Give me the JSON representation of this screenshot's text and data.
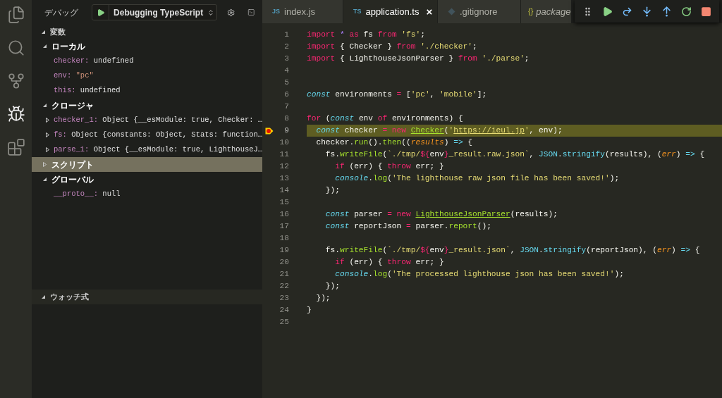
{
  "activity_bar": [
    {
      "kind": "files",
      "selected": false
    },
    {
      "kind": "search",
      "selected": false
    },
    {
      "kind": "source-control",
      "selected": false
    },
    {
      "kind": "debug",
      "selected": true
    },
    {
      "kind": "extensions",
      "selected": false
    }
  ],
  "sidebar": {
    "title": "デバッグ",
    "launch_config": "Debugging TypeScript"
  },
  "variables": {
    "title": "変数",
    "expanded": true,
    "scopes": [
      {
        "label": "ローカル",
        "expanded": true,
        "selected": false,
        "children": [
          {
            "name": "checker:",
            "value": {
              "text": "undefined",
              "kind": "plain"
            },
            "kind": "leaf"
          },
          {
            "name": "env:",
            "value": {
              "text": "\"pc\"",
              "kind": "string"
            },
            "kind": "leaf"
          },
          {
            "name": "this:",
            "value": {
              "text": "undefined",
              "kind": "plain"
            },
            "kind": "leaf"
          }
        ]
      },
      {
        "label": "クロージャ",
        "expanded": true,
        "selected": false,
        "children": [
          {
            "name": "checker_1:",
            "value": {
              "text": "Object {__esModule: true, Checker: …",
              "kind": "plain"
            },
            "kind": "object",
            "expanded": false
          },
          {
            "name": "fs:",
            "value": {
              "text": "Object {constants: Object, Stats: function…",
              "kind": "plain"
            },
            "kind": "object",
            "expanded": false
          },
          {
            "name": "parse_1:",
            "value": {
              "text": "Object {__esModule: true, LighthouseJ…",
              "kind": "plain"
            },
            "kind": "object",
            "expanded": false
          }
        ]
      },
      {
        "label": "スクリプト",
        "expanded": false,
        "selected": true
      },
      {
        "label": "グローバル",
        "expanded": true,
        "selected": false,
        "children": [
          {
            "name": "__proto__:",
            "value": {
              "text": "null",
              "kind": "plain"
            },
            "kind": "leaf"
          }
        ]
      }
    ]
  },
  "watch": {
    "title": "ウォッチ式",
    "expanded": true
  },
  "tabs": [
    {
      "label": "index.js",
      "badge": "JS",
      "kind": "js",
      "selected": false
    },
    {
      "label": "application.ts",
      "badge": "TS",
      "kind": "ts",
      "selected": true,
      "close": "×"
    },
    {
      "label": ".gitignore",
      "kind": "git",
      "selected": false
    },
    {
      "label": "package",
      "badge": "{}",
      "kind": "json",
      "selected": false
    }
  ],
  "debug_toolbar": [
    {
      "kind": "grip"
    },
    {
      "kind": "continue"
    },
    {
      "kind": "step-over"
    },
    {
      "kind": "step-into"
    },
    {
      "kind": "step-out"
    },
    {
      "kind": "restart"
    },
    {
      "kind": "stop"
    }
  ],
  "editor": {
    "lines": [
      {
        "number": "1",
        "current": false,
        "breakpoint": false,
        "tokens": [
          {
            "kind": "keyword",
            "text": "import "
          },
          {
            "kind": "constant",
            "text": "* "
          },
          {
            "kind": "keyword",
            "text": "as"
          },
          {
            "kind": "plain",
            "text": " fs "
          },
          {
            "kind": "keyword",
            "text": "from"
          },
          {
            "kind": "string",
            "text": " 'fs'"
          },
          {
            "kind": "plain",
            "text": ";"
          }
        ]
      },
      {
        "number": "2",
        "current": false,
        "breakpoint": false,
        "tokens": [
          {
            "kind": "keyword",
            "text": "import"
          },
          {
            "kind": "plain",
            "text": " { Checker } "
          },
          {
            "kind": "keyword",
            "text": "from"
          },
          {
            "kind": "string",
            "text": " './checker'"
          },
          {
            "kind": "plain",
            "text": ";"
          }
        ]
      },
      {
        "number": "3",
        "current": false,
        "breakpoint": false,
        "tokens": [
          {
            "kind": "keyword",
            "text": "import"
          },
          {
            "kind": "plain",
            "text": " { LighthouseJsonParser } "
          },
          {
            "kind": "keyword",
            "text": "from"
          },
          {
            "kind": "string",
            "text": " './parse'"
          },
          {
            "kind": "plain",
            "text": ";"
          }
        ]
      },
      {
        "number": "4",
        "current": false,
        "breakpoint": false
      },
      {
        "number": "5",
        "current": false,
        "breakpoint": false
      },
      {
        "number": "6",
        "current": false,
        "breakpoint": false,
        "tokens": [
          {
            "kind": "storage",
            "text": "const"
          },
          {
            "kind": "plain",
            "text": " environments "
          },
          {
            "kind": "keyword",
            "text": "="
          },
          {
            "kind": "plain",
            "text": " ["
          },
          {
            "kind": "string",
            "text": "'pc'"
          },
          {
            "kind": "plain",
            "text": ", "
          },
          {
            "kind": "string",
            "text": "'mobile'"
          },
          {
            "kind": "plain",
            "text": "];"
          }
        ]
      },
      {
        "number": "7",
        "current": false,
        "breakpoint": false
      },
      {
        "number": "8",
        "current": false,
        "breakpoint": false,
        "tokens": [
          {
            "kind": "keyword",
            "text": "for"
          },
          {
            "kind": "plain",
            "text": " ("
          },
          {
            "kind": "storage",
            "text": "const"
          },
          {
            "kind": "plain",
            "text": " env "
          },
          {
            "kind": "keyword",
            "text": "of"
          },
          {
            "kind": "plain",
            "text": " environments) {"
          }
        ]
      },
      {
        "number": "9",
        "current": true,
        "breakpoint": true,
        "tokens": [
          {
            "kind": "storage",
            "text": "  const"
          },
          {
            "kind": "plain",
            "text": " checker "
          },
          {
            "kind": "keyword",
            "text": "= new "
          },
          {
            "kind": "class",
            "text": "Checker"
          },
          {
            "kind": "plain",
            "text": "("
          },
          {
            "kind": "string",
            "text": "'"
          },
          {
            "kind": "link",
            "text": "https://ieul.jp"
          },
          {
            "kind": "string",
            "text": "'"
          },
          {
            "kind": "plain",
            "text": ", env);"
          }
        ]
      },
      {
        "number": "10",
        "current": false,
        "breakpoint": false,
        "tokens": [
          {
            "kind": "plain",
            "text": "  checker."
          },
          {
            "kind": "function",
            "text": "run"
          },
          {
            "kind": "plain",
            "text": "()."
          },
          {
            "kind": "function",
            "text": "then"
          },
          {
            "kind": "plain",
            "text": "(("
          },
          {
            "kind": "param",
            "text": "results"
          },
          {
            "kind": "plain",
            "text": ") "
          },
          {
            "kind": "arrow",
            "text": "=>"
          },
          {
            "kind": "plain",
            "text": " {"
          }
        ]
      },
      {
        "number": "11",
        "current": false,
        "breakpoint": false,
        "tokens": [
          {
            "kind": "plain",
            "text": "    fs."
          },
          {
            "kind": "function",
            "text": "writeFile"
          },
          {
            "kind": "plain",
            "text": "("
          },
          {
            "kind": "string",
            "text": "`./tmp/"
          },
          {
            "kind": "keyword",
            "text": "${"
          },
          {
            "kind": "plain",
            "text": "env"
          },
          {
            "kind": "keyword",
            "text": "}"
          },
          {
            "kind": "string",
            "text": "_result.raw.json`"
          },
          {
            "kind": "plain",
            "text": ", "
          },
          {
            "kind": "builtin",
            "text": "JSON"
          },
          {
            "kind": "plain",
            "text": "."
          },
          {
            "kind": "builtin",
            "text": "stringify"
          },
          {
            "kind": "plain",
            "text": "(results), ("
          },
          {
            "kind": "param",
            "text": "err"
          },
          {
            "kind": "plain",
            "text": ") "
          },
          {
            "kind": "arrow",
            "text": "=>"
          },
          {
            "kind": "plain",
            "text": " {"
          }
        ]
      },
      {
        "number": "12",
        "current": false,
        "breakpoint": false,
        "tokens": [
          {
            "kind": "keyword",
            "text": "      if"
          },
          {
            "kind": "plain",
            "text": " (err) { "
          },
          {
            "kind": "keyword",
            "text": "throw"
          },
          {
            "kind": "plain",
            "text": " err; }"
          }
        ]
      },
      {
        "number": "13",
        "current": false,
        "breakpoint": false,
        "tokens": [
          {
            "kind": "console",
            "text": "      console"
          },
          {
            "kind": "plain",
            "text": "."
          },
          {
            "kind": "function",
            "text": "log"
          },
          {
            "kind": "plain",
            "text": "("
          },
          {
            "kind": "string",
            "text": "'The lighthouse raw json file has been saved!'"
          },
          {
            "kind": "plain",
            "text": ");"
          }
        ]
      },
      {
        "number": "14",
        "current": false,
        "breakpoint": false,
        "tokens": [
          {
            "kind": "plain",
            "text": "    });"
          }
        ]
      },
      {
        "number": "15",
        "current": false,
        "breakpoint": false
      },
      {
        "number": "16",
        "current": false,
        "breakpoint": false,
        "tokens": [
          {
            "kind": "storage",
            "text": "    const"
          },
          {
            "kind": "plain",
            "text": " parser "
          },
          {
            "kind": "keyword",
            "text": "= new "
          },
          {
            "kind": "class",
            "text": "LighthouseJsonParser"
          },
          {
            "kind": "plain",
            "text": "(results);"
          }
        ]
      },
      {
        "number": "17",
        "current": false,
        "breakpoint": false,
        "tokens": [
          {
            "kind": "storage",
            "text": "    const"
          },
          {
            "kind": "plain",
            "text": " reportJson "
          },
          {
            "kind": "keyword",
            "text": "="
          },
          {
            "kind": "plain",
            "text": " parser."
          },
          {
            "kind": "function",
            "text": "report"
          },
          {
            "kind": "plain",
            "text": "();"
          }
        ]
      },
      {
        "number": "18",
        "current": false,
        "breakpoint": false
      },
      {
        "number": "19",
        "current": false,
        "breakpoint": false,
        "tokens": [
          {
            "kind": "plain",
            "text": "    fs."
          },
          {
            "kind": "function",
            "text": "writeFile"
          },
          {
            "kind": "plain",
            "text": "("
          },
          {
            "kind": "string",
            "text": "`./tmp/"
          },
          {
            "kind": "keyword",
            "text": "${"
          },
          {
            "kind": "plain",
            "text": "env"
          },
          {
            "kind": "keyword",
            "text": "}"
          },
          {
            "kind": "string",
            "text": "_result.json`"
          },
          {
            "kind": "plain",
            "text": ", "
          },
          {
            "kind": "builtin",
            "text": "JSON"
          },
          {
            "kind": "plain",
            "text": "."
          },
          {
            "kind": "builtin",
            "text": "stringify"
          },
          {
            "kind": "plain",
            "text": "(reportJson), ("
          },
          {
            "kind": "param",
            "text": "err"
          },
          {
            "kind": "plain",
            "text": ") "
          },
          {
            "kind": "arrow",
            "text": "=>"
          },
          {
            "kind": "plain",
            "text": " {"
          }
        ]
      },
      {
        "number": "20",
        "current": false,
        "breakpoint": false,
        "tokens": [
          {
            "kind": "keyword",
            "text": "      if"
          },
          {
            "kind": "plain",
            "text": " (err) { "
          },
          {
            "kind": "keyword",
            "text": "throw"
          },
          {
            "kind": "plain",
            "text": " err; }"
          }
        ]
      },
      {
        "number": "21",
        "current": false,
        "breakpoint": false,
        "tokens": [
          {
            "kind": "console",
            "text": "      console"
          },
          {
            "kind": "plain",
            "text": "."
          },
          {
            "kind": "function",
            "text": "log"
          },
          {
            "kind": "plain",
            "text": "("
          },
          {
            "kind": "string",
            "text": "'The processed lighthouse json has been saved!'"
          },
          {
            "kind": "plain",
            "text": ");"
          }
        ]
      },
      {
        "number": "22",
        "current": false,
        "breakpoint": false,
        "tokens": [
          {
            "kind": "plain",
            "text": "    });"
          }
        ]
      },
      {
        "number": "23",
        "current": false,
        "breakpoint": false,
        "tokens": [
          {
            "kind": "plain",
            "text": "  });"
          }
        ]
      },
      {
        "number": "24",
        "current": false,
        "breakpoint": false,
        "tokens": [
          {
            "kind": "plain",
            "text": "}"
          }
        ]
      },
      {
        "number": "25",
        "current": false,
        "breakpoint": false
      }
    ]
  }
}
